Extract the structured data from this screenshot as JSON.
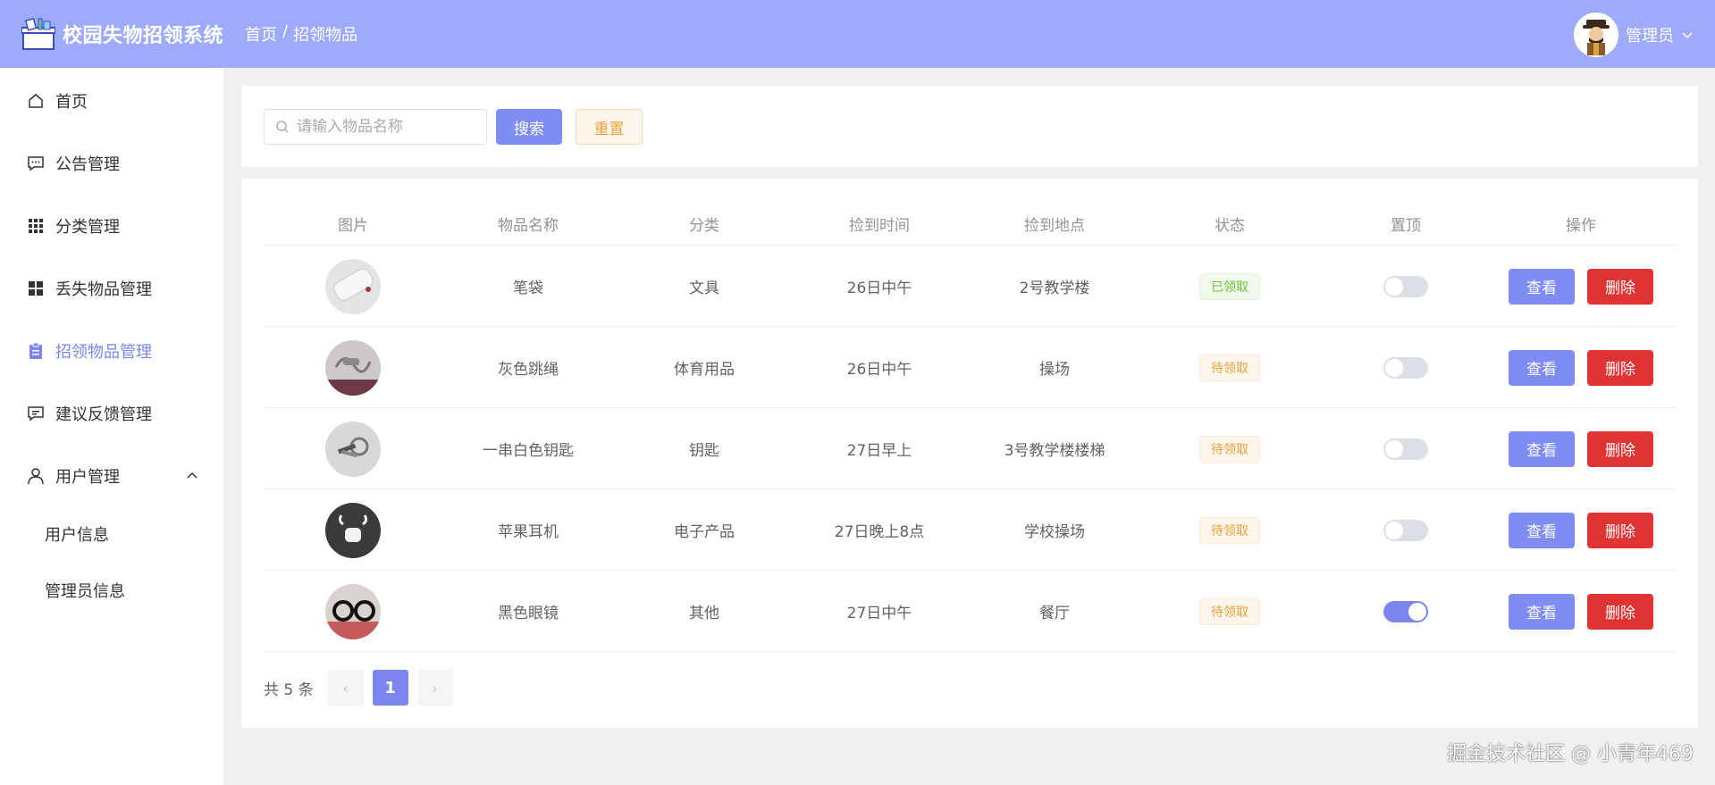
{
  "header": {
    "app_title": "校园失物招领系统",
    "breadcrumb": [
      "首页",
      "/",
      "招领物品"
    ],
    "user_name": "管理员",
    "bg_color": "#9eaafc"
  },
  "sidebar": {
    "items": [
      {
        "label": "首页",
        "icon": "home-icon"
      },
      {
        "label": "公告管理",
        "icon": "chat-dots-icon"
      },
      {
        "label": "分类管理",
        "icon": "grid-icon"
      },
      {
        "label": "丢失物品管理",
        "icon": "menu-blocks-icon"
      },
      {
        "label": "招领物品管理",
        "icon": "clipboard-icon",
        "active": true
      },
      {
        "label": "建议反馈管理",
        "icon": "message-icon"
      },
      {
        "label": "用户管理",
        "icon": "user-icon",
        "expanded": true
      }
    ],
    "sub_items": [
      {
        "label": "用户信息"
      },
      {
        "label": "管理员信息"
      }
    ],
    "active_color": "#7b86f0"
  },
  "search": {
    "placeholder": "请输入物品名称",
    "value": "",
    "search_label": "搜索",
    "reset_label": "重置"
  },
  "table": {
    "columns": [
      "图片",
      "物品名称",
      "分类",
      "捡到时间",
      "捡到地点",
      "状态",
      "置顶",
      "操作"
    ],
    "rows": [
      {
        "name": "笔袋",
        "category": "文具",
        "time": "26日中午",
        "place": "2号教学楼",
        "status": "已领取",
        "status_type": "done",
        "top": false,
        "thumb": "pencil-case"
      },
      {
        "name": "灰色跳绳",
        "category": "体育用品",
        "time": "26日中午",
        "place": "操场",
        "status": "待领取",
        "status_type": "wait",
        "top": false,
        "thumb": "jump-rope"
      },
      {
        "name": "一串白色钥匙",
        "category": "钥匙",
        "time": "27日早上",
        "place": "3号教学楼楼梯",
        "status": "待领取",
        "status_type": "wait",
        "top": false,
        "thumb": "keys"
      },
      {
        "name": "苹果耳机",
        "category": "电子产品",
        "time": "27日晚上8点",
        "place": "学校操场",
        "status": "待领取",
        "status_type": "wait",
        "top": false,
        "thumb": "earbuds"
      },
      {
        "name": "黑色眼镜",
        "category": "其他",
        "time": "27日中午",
        "place": "餐厅",
        "status": "待领取",
        "status_type": "wait",
        "top": true,
        "thumb": "glasses"
      }
    ],
    "view_label": "查看",
    "delete_label": "删除"
  },
  "pagination": {
    "total_text": "共 5 条",
    "current_page": "1",
    "prev_icon": "‹",
    "next_icon": "›"
  },
  "watermark": "掘金技术社区 @ 小青年469"
}
